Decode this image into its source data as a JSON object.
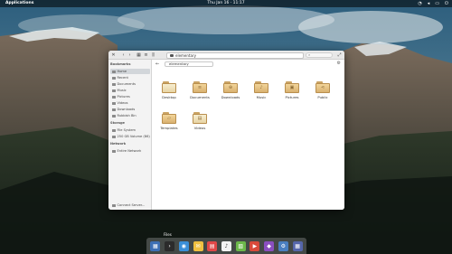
{
  "panel": {
    "applications_label": "Applications",
    "clock": "Thu Jan 16 · 11:17",
    "indicators": [
      "network-icon",
      "volume-icon",
      "battery-icon",
      "power-icon"
    ]
  },
  "window": {
    "path": "elementary",
    "location": "elementary",
    "search_placeholder": ""
  },
  "sidebar": {
    "bookmarks_heading": "Bookmarks",
    "bookmarks": [
      {
        "label": "Home",
        "icon": "home-icon",
        "active": true
      },
      {
        "label": "Recent",
        "icon": "clock-icon",
        "active": false
      },
      {
        "label": "Documents",
        "icon": "document-icon",
        "active": false
      },
      {
        "label": "Music",
        "icon": "music-icon",
        "active": false
      },
      {
        "label": "Pictures",
        "icon": "pictures-icon",
        "active": false
      },
      {
        "label": "Videos",
        "icon": "video-icon",
        "active": false
      },
      {
        "label": "Downloads",
        "icon": "download-icon",
        "active": false
      },
      {
        "label": "Rubbish Bin",
        "icon": "trash-icon",
        "active": false
      }
    ],
    "storage_heading": "Storage",
    "storage": [
      {
        "label": "File System",
        "icon": "drive-icon"
      },
      {
        "label": "250 GB Volume (86)",
        "icon": "drive-icon"
      }
    ],
    "network_heading": "Network",
    "network": [
      {
        "label": "Entire Network",
        "icon": "network-icon"
      }
    ],
    "connect_server": "Connect Server..."
  },
  "files": [
    {
      "name": "Desktop",
      "glyph": "",
      "style": "plain"
    },
    {
      "name": "Documents",
      "glyph": "≡",
      "style": "color"
    },
    {
      "name": "Downloads",
      "glyph": "⊕",
      "style": "color"
    },
    {
      "name": "Music",
      "glyph": "♪",
      "style": "color"
    },
    {
      "name": "Pictures",
      "glyph": "▣",
      "style": "color"
    },
    {
      "name": "Public",
      "glyph": "⋖",
      "style": "color"
    },
    {
      "name": "Templates",
      "glyph": "▱",
      "style": "color"
    },
    {
      "name": "Videos",
      "glyph": "▤",
      "style": "plain"
    }
  ],
  "dock": {
    "hover_label": "Files",
    "apps": [
      {
        "name": "files-icon",
        "color": "#3d6fb4",
        "glyph": "▦"
      },
      {
        "name": "terminal-icon",
        "color": "#2b2b2b",
        "glyph": "›"
      },
      {
        "name": "browser-icon",
        "color": "#3a8fd8",
        "glyph": "◉"
      },
      {
        "name": "mail-icon",
        "color": "#f0c040",
        "glyph": "✉"
      },
      {
        "name": "calendar-icon",
        "color": "#e04848",
        "glyph": "▤"
      },
      {
        "name": "music-icon",
        "color": "#f2f2f2",
        "glyph": "♪"
      },
      {
        "name": "photos-icon",
        "color": "#6cb84a",
        "glyph": "▧"
      },
      {
        "name": "videos-icon",
        "color": "#d84a3a",
        "glyph": "▶"
      },
      {
        "name": "appcenter-icon",
        "color": "#8a4fbf",
        "glyph": "◆"
      },
      {
        "name": "settings-icon",
        "color": "#4a7fc0",
        "glyph": "⚙"
      },
      {
        "name": "workspaces-icon",
        "color": "#5566aa",
        "glyph": "▦"
      }
    ]
  }
}
